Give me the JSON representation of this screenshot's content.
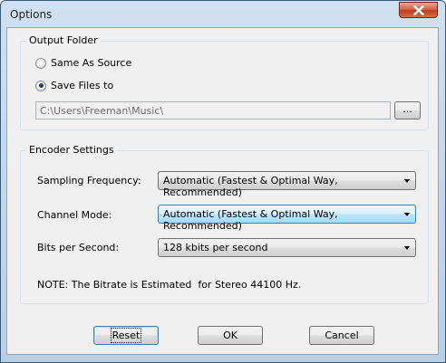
{
  "window": {
    "title": "Options"
  },
  "output_folder": {
    "group_label": "Output Folder",
    "same_as_source_label": "Same As Source",
    "same_as_source_checked": false,
    "save_files_to_label": "Save Files to",
    "save_files_to_checked": true,
    "path_value": "C:\\Users\\Freeman\\Music\\",
    "browse_label": "..."
  },
  "encoder_settings": {
    "group_label": "Encoder Settings",
    "sampling_frequency_label": "Sampling Frequency:",
    "sampling_frequency_value": "Automatic (Fastest & Optimal Way, Recommended)",
    "channel_mode_label": "Channel Mode:",
    "channel_mode_value": "Automatic (Fastest & Optimal Way, Recommended)",
    "bits_per_second_label": "Bits per Second:",
    "bits_per_second_value": "128 kbits per second",
    "note": "NOTE: The Bitrate is Estimated  for Stereo 44100 Hz."
  },
  "buttons": {
    "reset_label": "Reset",
    "ok_label": "OK",
    "cancel_label": "Cancel"
  }
}
